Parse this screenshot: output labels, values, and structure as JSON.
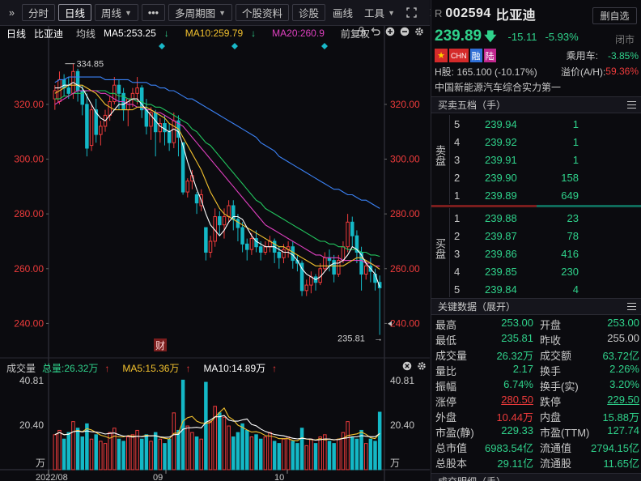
{
  "toolbar": {
    "collapse_glyph": "»",
    "items": [
      "分时",
      "日线",
      "周线",
      "•••",
      "多周期图",
      "个股资料",
      "诊股",
      "画线",
      "工具"
    ],
    "active": "日线"
  },
  "chart": {
    "period": "日线",
    "name": "比亚迪",
    "avg_label": "均线",
    "ma5": "MA5:253.25",
    "ma10": "MA10:259.79",
    "ma20": "MA20:260.9",
    "adjust": "前复权",
    "price_ticks": [
      "320.00",
      "300.00",
      "280.00",
      "260.00",
      "240.00"
    ],
    "high_marker": "334.85",
    "low_marker": "235.81",
    "finance_badge": "财",
    "colors": {
      "up": "#ef3b3b",
      "down": "#14b8c6",
      "ma5": "#ffffff",
      "ma10": "#f2c12e",
      "ma20": "#e040c0",
      "ma30": "#22c55e",
      "ma60": "#3b82f6"
    }
  },
  "volume": {
    "title": "成交量",
    "total": "总量:26.32万",
    "ma5": "MA5:15.36万",
    "ma10": "MA10:14.89万",
    "ticks": [
      "40.81",
      "20.40"
    ],
    "unit": "万",
    "dates": [
      "2022/08",
      "09",
      "10"
    ]
  },
  "quote": {
    "prefix": "R",
    "code": "002594",
    "name": "比亚迪",
    "delete_btn": "删自选",
    "price": "239.89",
    "change": "-15.11",
    "change_pct": "-5.93%",
    "status": "闭市",
    "flags": [
      "",
      "CHN",
      "融",
      "陆"
    ],
    "ride_label": "乘用车:",
    "ride_value": "-3.85%",
    "h_share": "H股: 165.100 (-10.17%)",
    "premium_label": "溢价(A/H):",
    "premium_value": "59.36%",
    "tagline": "中国新能源汽车综合实力第一"
  },
  "orderbook": {
    "title": "买卖五档（手）",
    "sell_label": "卖盘",
    "buy_label": "买盘",
    "sell": [
      {
        "lvl": "5",
        "price": "239.94",
        "vol": "1"
      },
      {
        "lvl": "4",
        "price": "239.92",
        "vol": "1"
      },
      {
        "lvl": "3",
        "price": "239.91",
        "vol": "1"
      },
      {
        "lvl": "2",
        "price": "239.90",
        "vol": "158"
      },
      {
        "lvl": "1",
        "price": "239.89",
        "vol": "649"
      }
    ],
    "buy": [
      {
        "lvl": "1",
        "price": "239.88",
        "vol": "23"
      },
      {
        "lvl": "2",
        "price": "239.87",
        "vol": "78"
      },
      {
        "lvl": "3",
        "price": "239.86",
        "vol": "416"
      },
      {
        "lvl": "4",
        "price": "239.85",
        "vol": "230"
      },
      {
        "lvl": "5",
        "price": "239.84",
        "vol": "4"
      }
    ]
  },
  "keydata": {
    "title": "关键数据（展开）",
    "rows": [
      {
        "l1": "最高",
        "v1": "253.00",
        "c1": "g",
        "l2": "开盘",
        "v2": "253.00",
        "c2": "g"
      },
      {
        "l1": "最低",
        "v1": "235.81",
        "c1": "g",
        "l2": "昨收",
        "v2": "255.00",
        "c2": "w"
      },
      {
        "l1": "成交量",
        "v1": "26.32万",
        "c1": "g",
        "l2": "成交额",
        "v2": "63.72亿",
        "c2": "g"
      },
      {
        "l1": "量比",
        "v1": "2.17",
        "c1": "g",
        "l2": "换手",
        "v2": "2.26%",
        "c2": "g"
      },
      {
        "l1": "振幅",
        "v1": "6.74%",
        "c1": "g",
        "l2": "换手(实)",
        "v2": "3.20%",
        "c2": "g"
      },
      {
        "l1": "涨停",
        "v1": "280.50",
        "c1": "r ul",
        "l2": "跌停",
        "v2": "229.50",
        "c2": "g ul"
      },
      {
        "l1": "外盘",
        "v1": "10.44万",
        "c1": "r",
        "l2": "内盘",
        "v2": "15.88万",
        "c2": "g"
      },
      {
        "l1": "市盈(静)",
        "v1": "229.33",
        "c1": "g",
        "l2": "市盈(TTM)",
        "v2": "127.74",
        "c2": "g"
      },
      {
        "l1": "总市值",
        "v1": "6983.54亿",
        "c1": "g",
        "l2": "流通值",
        "v2": "2794.15亿",
        "c2": "g"
      },
      {
        "l1": "总股本",
        "v1": "29.11亿",
        "c1": "g",
        "l2": "流通股",
        "v2": "11.65亿",
        "c2": "g"
      }
    ],
    "footer": "成交明细（手）"
  },
  "chart_data": {
    "type": "candlestick",
    "price_range": [
      228,
      338
    ],
    "volume_range": [
      0,
      43
    ],
    "candles": [
      [
        322,
        327,
        325,
        318,
        1
      ],
      [
        321,
        332,
        329,
        320,
        1
      ],
      [
        329,
        331,
        326,
        323,
        0
      ],
      [
        326,
        330,
        324,
        322,
        0
      ],
      [
        324,
        334.85,
        332,
        322,
        1
      ],
      [
        332,
        333,
        325,
        321,
        0
      ],
      [
        325,
        327,
        320,
        316,
        0
      ],
      [
        320,
        324,
        304,
        301,
        0
      ],
      [
        305,
        320,
        318,
        303,
        1
      ],
      [
        318,
        322,
        309,
        306,
        0
      ],
      [
        309,
        314,
        312,
        305,
        1
      ],
      [
        312,
        318,
        316,
        310,
        1
      ],
      [
        316,
        323,
        321,
        314,
        1
      ],
      [
        321,
        330,
        327,
        320,
        1
      ],
      [
        327,
        329,
        324,
        318,
        0
      ],
      [
        324,
        326,
        318,
        314,
        0
      ],
      [
        318,
        320,
        322,
        312,
        1
      ],
      [
        322,
        326,
        324,
        319,
        1
      ],
      [
        324,
        330,
        326,
        320,
        1
      ],
      [
        326,
        327,
        318,
        315,
        0
      ],
      [
        318,
        322,
        312,
        309,
        0
      ],
      [
        312,
        319,
        317,
        307,
        1
      ],
      [
        317,
        318,
        310,
        301,
        0
      ],
      [
        310,
        315,
        313,
        306,
        1
      ],
      [
        313,
        316,
        310,
        305,
        0
      ],
      [
        310,
        313,
        306,
        303,
        0
      ],
      [
        306,
        317,
        314,
        304,
        1
      ],
      [
        314,
        316,
        308,
        301,
        0
      ],
      [
        306,
        298,
        288,
        287,
        0
      ],
      [
        288,
        293,
        292,
        286,
        1
      ],
      [
        292,
        296,
        294,
        289,
        1
      ],
      [
        287,
        288,
        284,
        280,
        0
      ],
      [
        283,
        289,
        287,
        281,
        1
      ],
      [
        275,
        270,
        266,
        263,
        0
      ],
      [
        266,
        272,
        270,
        264,
        1
      ],
      [
        270,
        282,
        279,
        268,
        1
      ],
      [
        279,
        281,
        276,
        272,
        0
      ],
      [
        276,
        282,
        279,
        271,
        1
      ],
      [
        279,
        285,
        283,
        277,
        1
      ],
      [
        283,
        285,
        278,
        274,
        0
      ],
      [
        278,
        280,
        275,
        270,
        0
      ],
      [
        275,
        277,
        269,
        266,
        0
      ],
      [
        269,
        271,
        267,
        263,
        0
      ],
      [
        267,
        273,
        271,
        265,
        1
      ],
      [
        271,
        274,
        268,
        266,
        0
      ],
      [
        268,
        270,
        266,
        263,
        0
      ],
      [
        266,
        270,
        268,
        265,
        1
      ],
      [
        268,
        272,
        270,
        266,
        1
      ],
      [
        270,
        271,
        266,
        262,
        0
      ],
      [
        266,
        268,
        264,
        260,
        0
      ],
      [
        264,
        269,
        267,
        262,
        1
      ],
      [
        267,
        270,
        268,
        264,
        1
      ],
      [
        268,
        270,
        263,
        260,
        0
      ],
      [
        263,
        265,
        262,
        259,
        0
      ],
      [
        262,
        263,
        252,
        250,
        0
      ],
      [
        252,
        256,
        254,
        250,
        1
      ],
      [
        254,
        259,
        257,
        251,
        1
      ],
      [
        257,
        258,
        255,
        252,
        0
      ],
      [
        255,
        262,
        260,
        254,
        1
      ],
      [
        260,
        266,
        264,
        259,
        1
      ],
      [
        264,
        267,
        263,
        259,
        0
      ],
      [
        263,
        265,
        258,
        255,
        0
      ],
      [
        258,
        265,
        263,
        257,
        1
      ],
      [
        263,
        270,
        268,
        262,
        1
      ],
      [
        268,
        280,
        277,
        266,
        1
      ],
      [
        277,
        279,
        272,
        268,
        0
      ],
      [
        272,
        274,
        266,
        262,
        0
      ],
      [
        266,
        268,
        258,
        252,
        0
      ],
      [
        258,
        263,
        261,
        256,
        1
      ],
      [
        261,
        264,
        259,
        255,
        0
      ],
      [
        258,
        260,
        255,
        252,
        0
      ],
      [
        255,
        257.5,
        253,
        235.81,
        0
      ]
    ],
    "volumes": [
      16,
      18,
      14,
      17,
      22,
      19,
      15,
      21,
      14,
      16,
      13,
      12,
      17,
      19,
      14,
      13,
      15,
      16,
      18,
      14,
      16,
      13,
      17,
      14,
      12,
      14,
      26,
      18,
      41,
      20,
      17,
      15,
      14,
      40,
      22,
      29,
      26,
      24,
      20,
      15,
      17,
      21,
      18,
      15,
      16,
      14,
      15,
      17,
      13,
      12,
      14,
      15,
      13,
      12,
      19,
      11,
      14,
      12,
      15,
      16,
      13,
      12,
      14,
      17,
      22,
      15,
      14,
      18,
      12,
      14,
      13,
      26.32
    ],
    "ma_series": {
      "ma5": [
        326,
        326,
        327,
        327,
        328,
        327,
        326,
        323,
        320,
        317,
        315,
        314,
        316,
        318,
        320,
        320,
        321,
        322,
        322,
        320,
        318,
        316,
        314,
        312,
        311,
        310,
        311,
        310,
        305,
        299,
        294,
        289,
        285,
        280,
        276,
        274,
        272,
        274,
        277,
        279,
        279,
        278,
        275,
        272,
        270,
        269,
        268,
        268,
        268,
        267,
        266,
        266,
        265,
        263,
        260,
        258,
        257,
        256,
        257,
        259,
        261,
        262,
        262,
        263,
        265,
        268,
        267,
        265,
        262,
        260,
        258,
        253.25
      ],
      "ma10": [
        324,
        325,
        326,
        327,
        327,
        327,
        327,
        326,
        325,
        324,
        322,
        320,
        319,
        318,
        318,
        318,
        318,
        318,
        319,
        319,
        319,
        318,
        317,
        316,
        315,
        313,
        312,
        311,
        308,
        305,
        302,
        299,
        296,
        292,
        288,
        285,
        282,
        280,
        279,
        278,
        277,
        276,
        275,
        274,
        273,
        272,
        271,
        270,
        269,
        268,
        268,
        267,
        266,
        265,
        264,
        263,
        262,
        261,
        261,
        261,
        261,
        261,
        261,
        261,
        262,
        263,
        264,
        264,
        263,
        262,
        261,
        259.79
      ],
      "ma20": [
        320,
        321,
        322,
        323,
        324,
        325,
        325,
        325,
        325,
        325,
        324,
        324,
        323,
        322,
        321,
        321,
        320,
        320,
        319,
        319,
        318,
        318,
        317,
        317,
        316,
        315,
        314,
        313,
        312,
        310,
        308,
        306,
        304,
        302,
        300,
        298,
        296,
        294,
        292,
        290,
        288,
        286,
        284,
        282,
        280,
        278,
        276,
        275,
        274,
        273,
        272,
        271,
        270,
        269,
        268,
        267,
        266,
        265,
        265,
        264,
        264,
        264,
        264,
        263,
        263,
        263,
        263,
        263,
        262,
        262,
        261,
        260.9
      ],
      "ma30": [
        322,
        322,
        323,
        323,
        324,
        324,
        324,
        325,
        325,
        325,
        325,
        325,
        324,
        324,
        323,
        323,
        322,
        322,
        321,
        321,
        320,
        320,
        319,
        319,
        318,
        317,
        316,
        315,
        314,
        313,
        311,
        310,
        308,
        306,
        305,
        303,
        301,
        299,
        297,
        295,
        293,
        291,
        289,
        287,
        285,
        284,
        282,
        281,
        280,
        279,
        278,
        277,
        276,
        275,
        274,
        273,
        272,
        271,
        270,
        270,
        269,
        269,
        268,
        268,
        267,
        267,
        267,
        266,
        266,
        265,
        265,
        264.5
      ],
      "ma60": [
        328,
        329,
        329,
        330,
        330,
        330,
        330,
        330,
        330,
        330,
        330,
        329,
        329,
        329,
        329,
        329,
        329,
        328,
        328,
        328,
        328,
        327,
        327,
        326,
        326,
        325,
        325,
        324,
        323,
        322,
        322,
        321,
        320,
        319,
        318,
        317,
        316,
        315,
        314,
        313,
        312,
        311,
        310,
        309,
        308,
        306,
        305,
        304,
        303,
        301,
        300,
        299,
        298,
        297,
        296,
        295,
        294,
        293,
        292,
        291,
        290,
        289,
        289,
        288,
        287,
        287,
        286,
        285,
        285,
        284,
        283,
        282
      ]
    }
  }
}
